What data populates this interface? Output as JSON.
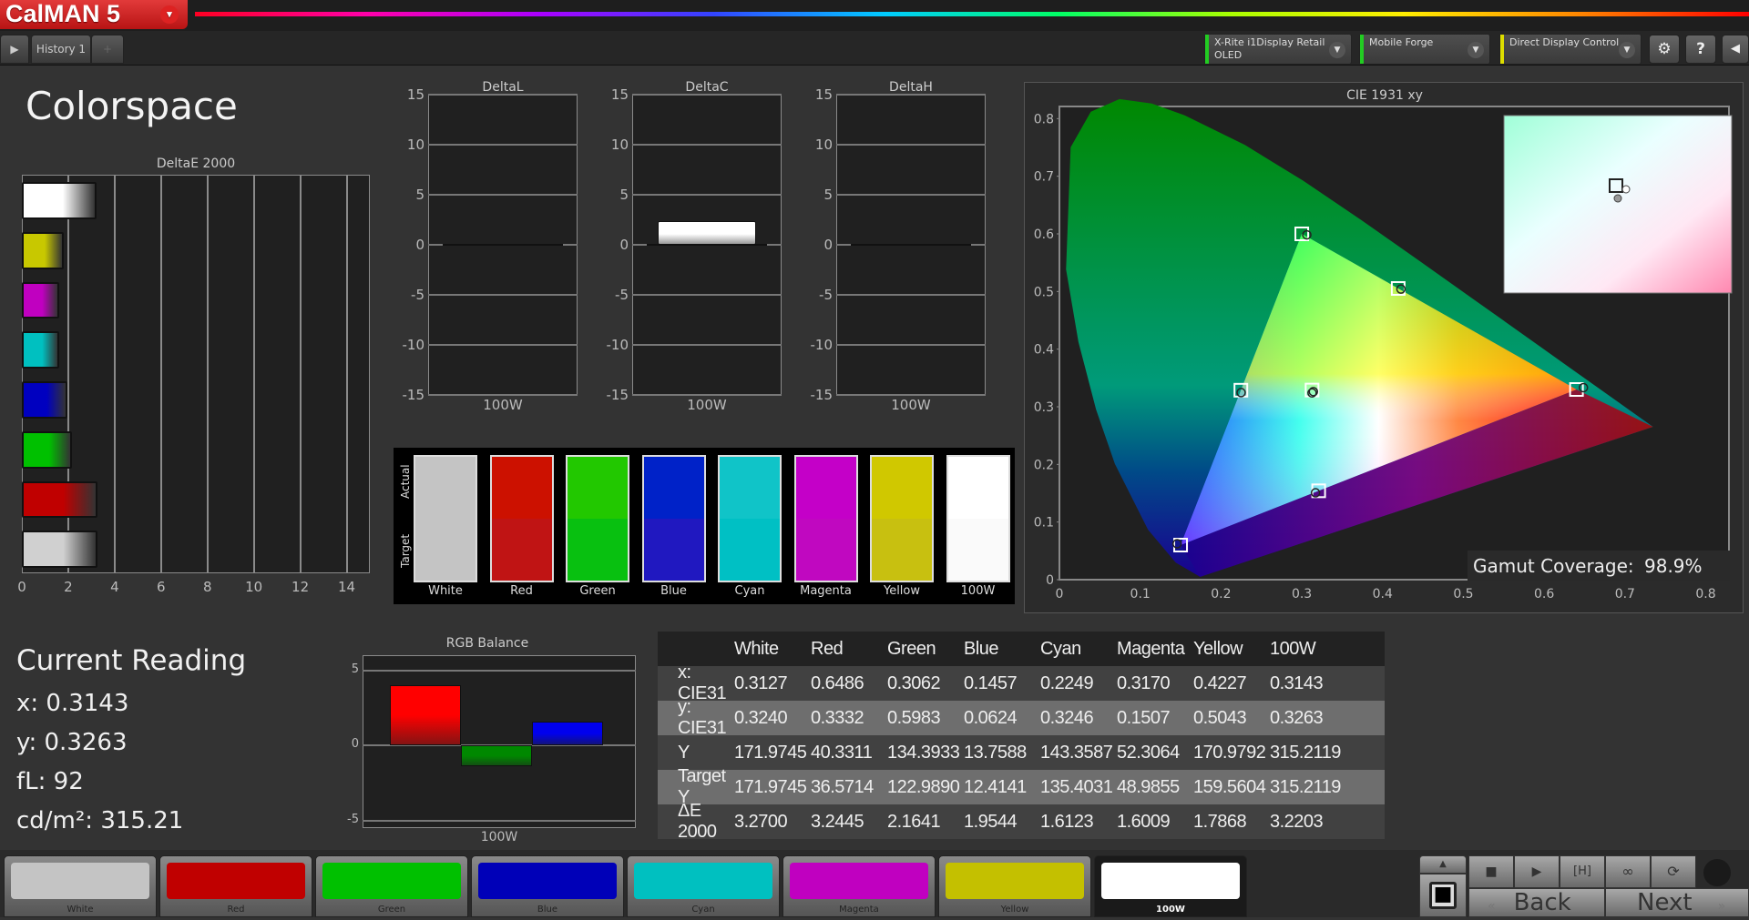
{
  "app": {
    "name": "CalMAN 5",
    "menu_arrow": "▾"
  },
  "tabs": {
    "play_icon": "▶",
    "history_label": "History 1",
    "add_icon": "+"
  },
  "devices": [
    {
      "line1": "X-Rite i1Display Retail",
      "line2": "OLED",
      "status_color": "#22cc22"
    },
    {
      "line1": "Mobile Forge",
      "line2": "",
      "status_color": "#22cc22"
    },
    {
      "line1": "Direct Display Control",
      "line2": "",
      "status_color": "#dddd00"
    }
  ],
  "toolbar_icons": {
    "settings": "⚙",
    "help": "?",
    "collapse": "◀"
  },
  "page_title": "Colorspace",
  "chart_data": [
    {
      "type": "bar",
      "title": "DeltaE 2000",
      "orientation": "horizontal",
      "categories": [
        "100W",
        "Yellow",
        "Magenta",
        "Cyan",
        "Blue",
        "Green",
        "Red",
        "White"
      ],
      "values": [
        3.2203,
        1.7868,
        1.6009,
        1.6123,
        1.9544,
        2.1641,
        3.2445,
        3.27
      ],
      "colors": [
        "#ffffff",
        "#c8c800",
        "#c000c0",
        "#00c0c0",
        "#0000c0",
        "#00c000",
        "#c00000",
        "#d0d0d0"
      ],
      "xlim": [
        0,
        15
      ],
      "xticks": [
        "0",
        "2",
        "4",
        "6",
        "8",
        "10",
        "12",
        "14"
      ],
      "grid": true
    },
    {
      "type": "bar",
      "title": "DeltaL",
      "categories": [
        "100W"
      ],
      "values": [
        0
      ],
      "ylim": [
        -15,
        15
      ],
      "yticks": [
        "15",
        "10",
        "5",
        "0",
        "-5",
        "-10",
        "-15"
      ]
    },
    {
      "type": "bar",
      "title": "DeltaC",
      "categories": [
        "100W"
      ],
      "values": [
        2.4
      ],
      "ylim": [
        -15,
        15
      ],
      "yticks": [
        "15",
        "10",
        "5",
        "0",
        "-5",
        "-10",
        "-15"
      ]
    },
    {
      "type": "bar",
      "title": "DeltaH",
      "categories": [
        "100W"
      ],
      "values": [
        0
      ],
      "ylim": [
        -15,
        15
      ],
      "yticks": [
        "15",
        "10",
        "5",
        "0",
        "-5",
        "-10",
        "-15"
      ]
    },
    {
      "type": "scatter",
      "title": "CIE 1931 xy",
      "xlim": [
        0,
        0.8
      ],
      "ylim": [
        0,
        0.8
      ],
      "xticks": [
        "0",
        "0.1",
        "0.2",
        "0.3",
        "0.4",
        "0.5",
        "0.6",
        "0.7",
        "0.8"
      ],
      "yticks": [
        "0",
        "0.1",
        "0.2",
        "0.3",
        "0.4",
        "0.5",
        "0.6",
        "0.7",
        "0.8"
      ],
      "targets": [
        {
          "name": "White",
          "x": 0.3127,
          "y": 0.329
        },
        {
          "name": "Red",
          "x": 0.64,
          "y": 0.33
        },
        {
          "name": "Green",
          "x": 0.3,
          "y": 0.6
        },
        {
          "name": "Blue",
          "x": 0.15,
          "y": 0.06
        },
        {
          "name": "Cyan",
          "x": 0.2246,
          "y": 0.3287
        },
        {
          "name": "Magenta",
          "x": 0.3209,
          "y": 0.1542
        },
        {
          "name": "Yellow",
          "x": 0.4193,
          "y": 0.5053
        }
      ],
      "actual": [
        {
          "name": "White",
          "x": 0.3127,
          "y": 0.324
        },
        {
          "name": "Red",
          "x": 0.6486,
          "y": 0.3332
        },
        {
          "name": "Green",
          "x": 0.3062,
          "y": 0.5983
        },
        {
          "name": "Blue",
          "x": 0.1457,
          "y": 0.0624
        },
        {
          "name": "Cyan",
          "x": 0.2249,
          "y": 0.3246
        },
        {
          "name": "Magenta",
          "x": 0.317,
          "y": 0.1507
        },
        {
          "name": "Yellow",
          "x": 0.4227,
          "y": 0.5043
        },
        {
          "name": "100W",
          "x": 0.3143,
          "y": 0.3263
        }
      ],
      "gamut_coverage_label": "Gamut Coverage:",
      "gamut_coverage_value": "98.9%"
    },
    {
      "type": "bar",
      "title": "RGB Balance",
      "categories": [
        "100W"
      ],
      "series": [
        {
          "name": "Red",
          "value": 4.0,
          "color": "#ff0000"
        },
        {
          "name": "Green",
          "value": -1.4,
          "color": "#008800"
        },
        {
          "name": "Blue",
          "value": 1.6,
          "color": "#0000ee"
        }
      ],
      "ylim": [
        -5.5,
        6
      ],
      "yticks": [
        "5",
        "0",
        "-5"
      ],
      "xlabel": "100W"
    }
  ],
  "swatches": {
    "actual_label": "Actual",
    "target_label": "Target",
    "items": [
      {
        "label": "White",
        "actual": "#c4c4c4",
        "target": "#c4c4c4"
      },
      {
        "label": "Red",
        "actual": "#cc1100",
        "target": "#c01414"
      },
      {
        "label": "Green",
        "actual": "#22c800",
        "target": "#08c010"
      },
      {
        "label": "Blue",
        "actual": "#0022c8",
        "target": "#2018c0"
      },
      {
        "label": "Cyan",
        "actual": "#10c4c8",
        "target": "#00c0c4"
      },
      {
        "label": "Magenta",
        "actual": "#c400c8",
        "target": "#c008c0"
      },
      {
        "label": "Yellow",
        "actual": "#d0c800",
        "target": "#c8c010"
      },
      {
        "label": "100W",
        "actual": "#ffffff",
        "target": "#fafafa"
      }
    ]
  },
  "reading": {
    "title": "Current Reading",
    "x": "x: 0.3143",
    "y": "y: 0.3263",
    "fl": "fL: 92",
    "cdm2": "cd/m²: 315.21"
  },
  "table": {
    "headers": [
      "",
      "White",
      "Red",
      "Green",
      "Blue",
      "Cyan",
      "Magenta",
      "Yellow",
      "100W"
    ],
    "rows": [
      [
        "x: CIE31",
        "0.3127",
        "0.6486",
        "0.3062",
        "0.1457",
        "0.2249",
        "0.3170",
        "0.4227",
        "0.3143"
      ],
      [
        "y: CIE31",
        "0.3240",
        "0.3332",
        "0.5983",
        "0.0624",
        "0.3246",
        "0.1507",
        "0.5043",
        "0.3263"
      ],
      [
        "Y",
        "171.9745",
        "40.3311",
        "134.3933",
        "13.7588",
        "143.3587",
        "52.3064",
        "170.9792",
        "315.2119"
      ],
      [
        "Target Y",
        "171.9745",
        "36.5714",
        "122.9890",
        "12.4141",
        "135.4031",
        "48.9855",
        "159.5604",
        "315.2119"
      ],
      [
        "ΔE 2000",
        "3.2700",
        "3.2445",
        "2.1641",
        "1.9544",
        "1.6123",
        "1.6009",
        "1.7868",
        "3.2203"
      ]
    ]
  },
  "patches": [
    {
      "label": "White",
      "color": "#c4c4c4"
    },
    {
      "label": "Red",
      "color": "#c00000"
    },
    {
      "label": "Green",
      "color": "#00c000"
    },
    {
      "label": "Blue",
      "color": "#0000b8"
    },
    {
      "label": "Cyan",
      "color": "#00c0c0"
    },
    {
      "label": "Magenta",
      "color": "#c000c0"
    },
    {
      "label": "Yellow",
      "color": "#c4c000"
    },
    {
      "label": "100W",
      "color": "#ffffff",
      "selected": true
    }
  ],
  "controls": {
    "up_icon": "▲",
    "stop_square_icon": "■",
    "stop_icon": "■",
    "play_icon": "▶",
    "hold_icon": "[H]",
    "loop_icon": "∞",
    "refresh_icon": "⟳",
    "back_label": "Back",
    "next_label": "Next",
    "back_icon": "«",
    "next_icon": "»"
  }
}
